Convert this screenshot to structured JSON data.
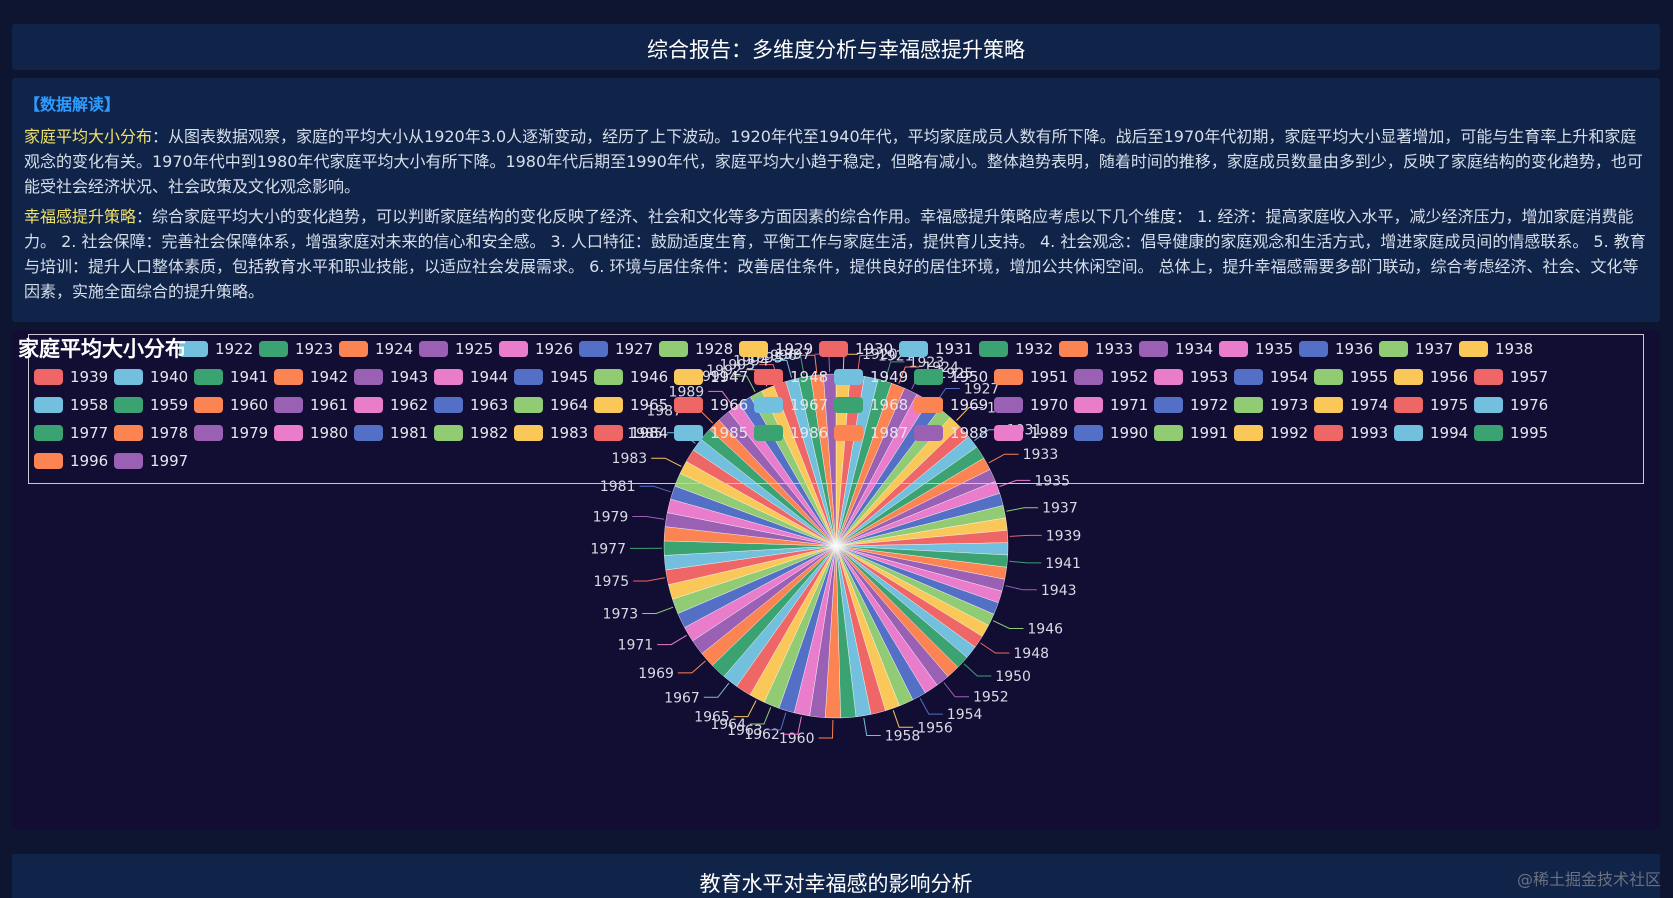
{
  "header": {
    "title": "综合报告：多维度分析与幸福感提升策略"
  },
  "interpretation": {
    "tag": "【数据解读】",
    "para1_label": "家庭平均大小分布",
    "para1_text": "：从图表数据观察，家庭的平均大小从1920年3.0人逐渐变动，经历了上下波动。1920年代至1940年代，平均家庭成员人数有所下降。战后至1970年代初期，家庭平均大小显著增加，可能与生育率上升和家庭观念的变化有关。1970年代中到1980年代家庭平均大小有所下降。1980年代后期至1990年代，家庭平均大小趋于稳定，但略有减小。整体趋势表明，随着时间的推移，家庭成员数量由多到少，反映了家庭结构的变化趋势，也可能受社会经济状况、社会政策及文化观念影响。",
    "para2_label": "幸福感提升策略",
    "para2_text": "：综合家庭平均大小的变化趋势，可以判断家庭结构的变化反映了经济、社会和文化等多方面因素的综合作用。幸福感提升策略应考虑以下几个维度： 1. 经济：提高家庭收入水平，减少经济压力，增加家庭消费能力。 2. 社会保障：完善社会保障体系，增强家庭对未来的信心和安全感。 3. 人口特征：鼓励适度生育，平衡工作与家庭生活，提供育儿支持。 4. 社会观念：倡导健康的家庭观念和生活方式，增进家庭成员间的情感联系。 5. 教育与培训：提升人口整体素质，包括教育水平和职业技能，以适应社会发展需求。 6. 环境与居住条件：改善居住条件，提供良好的居住环境，增加公共休闲空间。 总体上，提升幸福感需要多部门联动，综合考虑经济、社会、文化等因素，实施全面综合的提升策略。"
  },
  "chart_data": {
    "type": "pie",
    "title": "家庭平均大小分布",
    "legend_position": "top",
    "palette": [
      "#5470c6",
      "#91cc75",
      "#fac858",
      "#ee6666",
      "#73c0de",
      "#3ba272",
      "#fc8452",
      "#9a60b4",
      "#ea7ccc"
    ],
    "categories": [
      "1920",
      "1921",
      "1922",
      "1923",
      "1924",
      "1925",
      "1926",
      "1927",
      "1928",
      "1929",
      "1930",
      "1931",
      "1932",
      "1933",
      "1934",
      "1935",
      "1936",
      "1937",
      "1938",
      "1939",
      "1940",
      "1941",
      "1942",
      "1943",
      "1944",
      "1945",
      "1946",
      "1947",
      "1948",
      "1949",
      "1950",
      "1951",
      "1952",
      "1953",
      "1954",
      "1955",
      "1956",
      "1957",
      "1958",
      "1959",
      "1960",
      "1961",
      "1962",
      "1963",
      "1964",
      "1965",
      "1966",
      "1967",
      "1968",
      "1969",
      "1970",
      "1971",
      "1972",
      "1973",
      "1974",
      "1975",
      "1976",
      "1977",
      "1978",
      "1979",
      "1980",
      "1981",
      "1982",
      "1983",
      "1984",
      "1985",
      "1986",
      "1987",
      "1988",
      "1989",
      "1990",
      "1991",
      "1992",
      "1993",
      "1994",
      "1995",
      "1996",
      "1997"
    ],
    "values": [
      3.0,
      2.97,
      2.95,
      2.93,
      2.9,
      2.88,
      2.86,
      2.84,
      2.82,
      2.8,
      2.78,
      2.76,
      2.74,
      2.72,
      2.7,
      2.68,
      2.66,
      2.64,
      2.62,
      2.6,
      2.58,
      2.57,
      2.56,
      2.55,
      2.55,
      2.56,
      2.6,
      2.65,
      2.7,
      2.75,
      2.8,
      2.85,
      2.9,
      2.95,
      3.0,
      3.05,
      3.1,
      3.14,
      3.18,
      3.22,
      3.25,
      3.28,
      3.3,
      3.32,
      3.33,
      3.34,
      3.35,
      3.35,
      3.34,
      3.32,
      3.3,
      3.27,
      3.24,
      3.2,
      3.16,
      3.12,
      3.08,
      3.04,
      3.0,
      2.96,
      2.92,
      2.88,
      2.85,
      2.82,
      2.8,
      2.78,
      2.76,
      2.75,
      2.74,
      2.73,
      2.72,
      2.71,
      2.7,
      2.69,
      2.68,
      2.67,
      2.66,
      2.65
    ],
    "visible_slice_labels": [
      "1920",
      "1921",
      "1923",
      "1924",
      "1925",
      "1927",
      "1929",
      "1931",
      "1933",
      "1935",
      "1937",
      "1939",
      "1941",
      "1943",
      "1946",
      "1948",
      "1950",
      "1952",
      "1954",
      "1956",
      "1958",
      "1960",
      "1962",
      "1963",
      "1964",
      "1965",
      "1967",
      "1969",
      "1971",
      "1973",
      "1975",
      "1977",
      "1979",
      "1981",
      "1983",
      "1985",
      "1987",
      "1989",
      "1991",
      "1992",
      "1993",
      "1994",
      "1995",
      "1996",
      "1997"
    ]
  },
  "section2": {
    "title": "教育水平对幸福感的影响分析"
  },
  "watermark": "@稀土掘金技术社区"
}
